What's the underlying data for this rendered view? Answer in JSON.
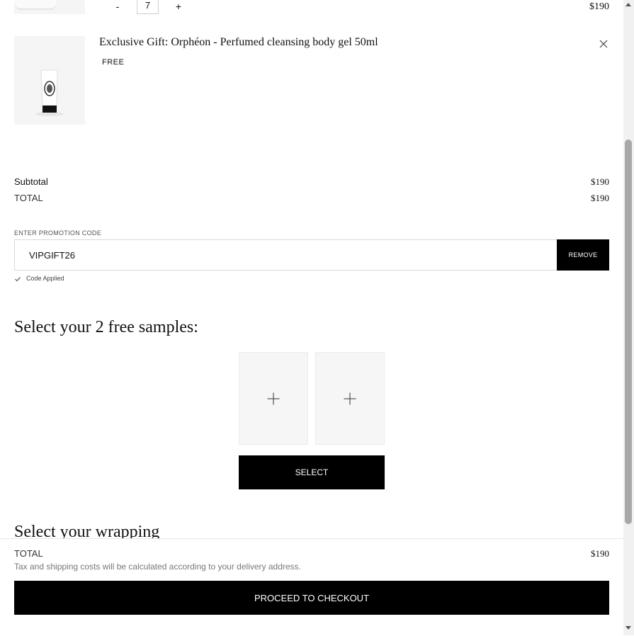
{
  "cart": {
    "previous_item": {
      "qty_minus": "-",
      "quantity": "7",
      "qty_plus": "+",
      "price": "$190"
    },
    "gift_item": {
      "name": "Exclusive Gift: Orphéon - Perfumed cleansing body gel 50ml",
      "price_label": "FREE",
      "remove_icon": "close-icon"
    }
  },
  "totals": {
    "subtotal_label": "Subtotal",
    "subtotal_value": "$190",
    "total_label": "TOTAL",
    "total_value": "$190"
  },
  "promo": {
    "label": "ENTER PROMOTION CODE",
    "value": "VIPGIFT26",
    "button_label": "REMOVE",
    "status": "Code Applied",
    "status_icon": "checkmark-icon"
  },
  "samples": {
    "title": "Select your 2 free samples:",
    "slot_icon": "plus-icon",
    "button_label": "SELECT"
  },
  "wrapping": {
    "title": "Select your wrapping"
  },
  "summary_bar": {
    "total_label": "TOTAL",
    "total_value": "$190",
    "note": "Tax and shipping costs will be calculated according to your delivery address.",
    "checkout_label": "PROCEED TO CHECKOUT"
  },
  "colors": {
    "primary_button": "#000000",
    "thumb_bg": "#f5f5f5"
  }
}
